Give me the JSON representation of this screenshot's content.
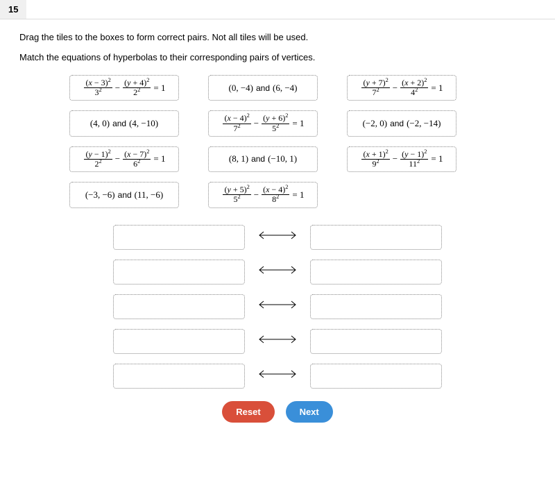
{
  "question_number": "15",
  "instruction_line1": "Drag the tiles to the boxes to form correct pairs. Not all tiles will be used.",
  "instruction_line2": "Match the equations of hyperbolas to their corresponding pairs of vertices.",
  "tiles": {
    "r1c1": {
      "type": "equation",
      "num1_var": "x",
      "num1_op": "−",
      "num1_k": "3",
      "den1": "3",
      "num2_var": "y",
      "num2_op": "+",
      "num2_k": "4",
      "den2": "2"
    },
    "r1c2": {
      "type": "pair",
      "p1": "(0, −4)",
      "p2": "(6, −4)"
    },
    "r1c3": {
      "type": "equation",
      "num1_var": "y",
      "num1_op": "+",
      "num1_k": "7",
      "den1": "7",
      "num2_var": "x",
      "num2_op": "+",
      "num2_k": "2",
      "den2": "4"
    },
    "r2c1": {
      "type": "pair",
      "p1": "(4, 0)",
      "p2": "(4, −10)"
    },
    "r2c2": {
      "type": "equation",
      "num1_var": "x",
      "num1_op": "−",
      "num1_k": "4",
      "den1": "7",
      "num2_var": "y",
      "num2_op": "+",
      "num2_k": "6",
      "den2": "5"
    },
    "r2c3": {
      "type": "pair",
      "p1": "(−2, 0)",
      "p2": "(−2, −14)"
    },
    "r3c1": {
      "type": "equation",
      "num1_var": "y",
      "num1_op": "−",
      "num1_k": "1",
      "den1": "2",
      "num2_var": "x",
      "num2_op": "−",
      "num2_k": "7",
      "den2": "6"
    },
    "r3c2": {
      "type": "pair",
      "p1": "(8, 1)",
      "p2": "(−10, 1)"
    },
    "r3c3": {
      "type": "equation",
      "num1_var": "x",
      "num1_op": "+",
      "num1_k": "1",
      "den1": "9",
      "num2_var": "y",
      "num2_op": "−",
      "num2_k": "1",
      "den2": "11"
    },
    "r4c1": {
      "type": "pair",
      "p1": "(−3, −6)",
      "p2": "(11, −6)"
    },
    "r4c2": {
      "type": "equation",
      "num1_var": "y",
      "num1_op": "+",
      "num1_k": "5",
      "den1": "5",
      "num2_var": "x",
      "num2_op": "−",
      "num2_k": "4",
      "den2": "8"
    }
  },
  "match_rows": 5,
  "buttons": {
    "reset": "Reset",
    "next": "Next"
  },
  "and_label": "and",
  "minus": "−",
  "equals_one": "= 1"
}
